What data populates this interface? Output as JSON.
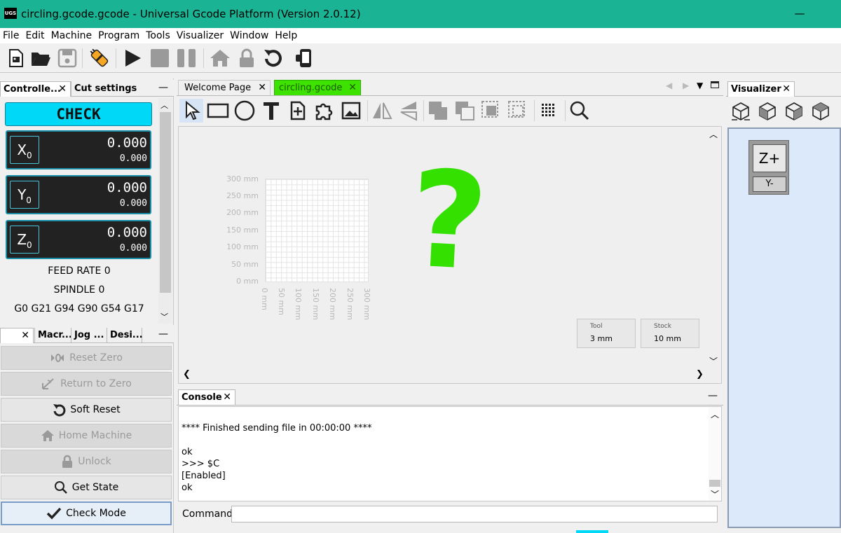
{
  "window": {
    "title": "circling.gcode.gcode - Universal Gcode Platform (Version 2.0.12)",
    "logo": "UGS",
    "minimize": "—"
  },
  "menu": [
    "File",
    "Edit",
    "Machine",
    "Program",
    "Tools",
    "Visualizer",
    "Window",
    "Help"
  ],
  "colors": {
    "titlebar": "#1ab394",
    "check_banner": "#00d8f8",
    "active_tab": "#3de200",
    "question_mark": "#33e000",
    "visualizer_bg": "#dce9fb",
    "dro_border": "#1a8fa8"
  },
  "left_top": {
    "tabs": [
      "Controlle...",
      "Cut settings"
    ],
    "state_banner": "CHECK",
    "dro": [
      {
        "axis": "X0",
        "work": "0.000",
        "machine": "0.000"
      },
      {
        "axis": "Y0",
        "work": "0.000",
        "machine": "0.000"
      },
      {
        "axis": "Z0",
        "work": "0.000",
        "machine": "0.000"
      }
    ],
    "feed_rate": "FEED RATE 0",
    "spindle": "SPINDLE 0",
    "gcode_state": "G0 G21 G94 G90 G54 G17"
  },
  "left_bottom": {
    "tabs": [
      "Macr...",
      "Jog ...",
      "Desi..."
    ],
    "buttons": [
      {
        "label": "Reset Zero",
        "icon": "reset-zero-icon",
        "enabled": false
      },
      {
        "label": "Return to Zero",
        "icon": "return-to-zero-icon",
        "enabled": false
      },
      {
        "label": "Soft Reset",
        "icon": "undo-icon",
        "enabled": true
      },
      {
        "label": "Home Machine",
        "icon": "home-icon",
        "enabled": false
      },
      {
        "label": "Unlock",
        "icon": "lock-icon",
        "enabled": false
      },
      {
        "label": "Get State",
        "icon": "magnifier-icon",
        "enabled": true
      },
      {
        "label": "Check Mode",
        "icon": "checkmark-icon",
        "enabled": true
      }
    ]
  },
  "editor": {
    "tabs": [
      "Welcome Page",
      "circling.gcode"
    ],
    "y_axis": [
      "300 mm",
      "250 mm",
      "200 mm",
      "150 mm",
      "100 mm",
      "50 mm",
      "0 mm"
    ],
    "x_axis": [
      "0 mm",
      "50 mm",
      "100 mm",
      "150 mm",
      "200 mm",
      "250 mm",
      "300 mm"
    ],
    "question": "?",
    "tool_label": "Tool",
    "tool_value": "3 mm",
    "stock_label": "Stock",
    "stock_value": "10 mm"
  },
  "console": {
    "tab": "Console",
    "lines": [
      "",
      "**** Finished sending file in 00:00:00 ****",
      "",
      "ok",
      ">>> $C",
      "[Enabled]",
      "ok"
    ],
    "command_label": "Command:",
    "command_value": ""
  },
  "visualizer": {
    "tab": "Visualizer",
    "view_z": "Z+",
    "view_y": "Y-"
  }
}
